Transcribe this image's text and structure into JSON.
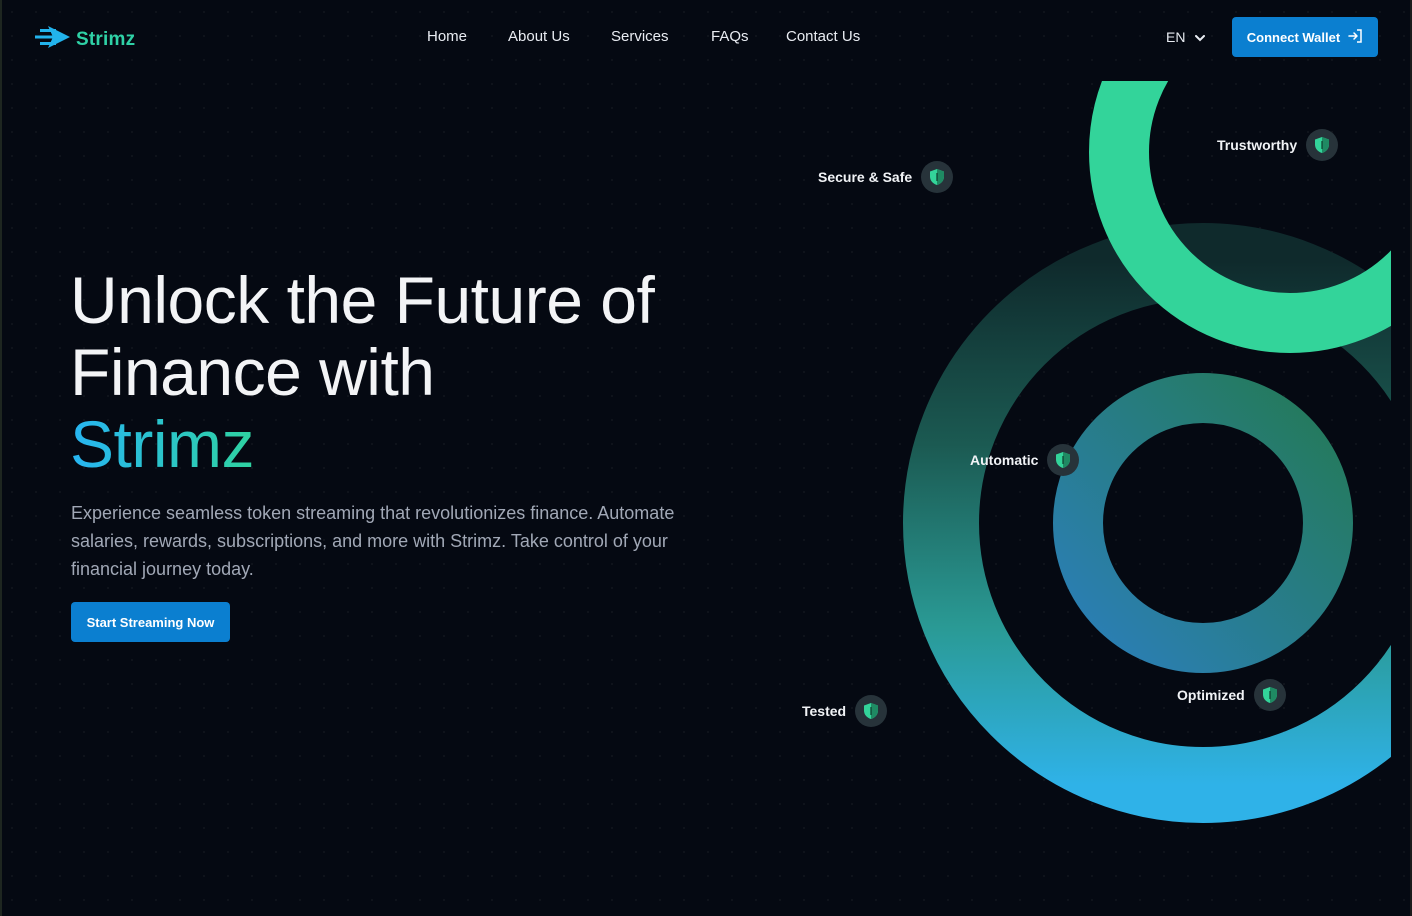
{
  "header": {
    "logo_text": "Strimz",
    "nav": [
      {
        "label": "Home"
      },
      {
        "label": "About Us"
      },
      {
        "label": "Services"
      },
      {
        "label": "FAQs"
      },
      {
        "label": "Contact Us"
      }
    ],
    "language": "EN",
    "connect_wallet_label": "Connect Wallet"
  },
  "hero": {
    "title_line1": "Unlock the Future of",
    "title_line2": "Finance with",
    "title_brand": "Strimz",
    "description": "Experience seamless token streaming that revolutionizes finance. Automate salaries, rewards, subscriptions, and more with Strimz. Take control of your financial journey today.",
    "cta_label": "Start Streaming Now"
  },
  "features": [
    {
      "label": "Secure & Safe",
      "icon": "shield-icon"
    },
    {
      "label": "Trustworthy",
      "icon": "shield-icon"
    },
    {
      "label": "Automatic",
      "icon": "shield-icon"
    },
    {
      "label": "Tested",
      "icon": "shield-icon"
    },
    {
      "label": "Optimized",
      "icon": "shield-icon"
    }
  ],
  "colors": {
    "background": "#050912",
    "accent_blue": "#0b7fd0",
    "accent_green": "#33d49a",
    "gradient_start": "#27b5f3",
    "gradient_end": "#2fd3a1",
    "text_muted": "#a1a8b6"
  }
}
